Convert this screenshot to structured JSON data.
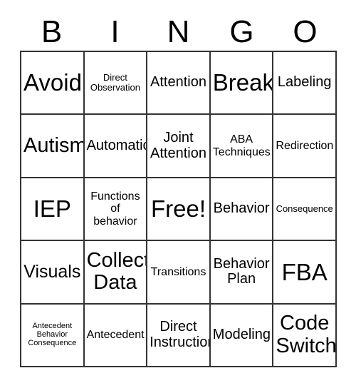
{
  "card": {
    "title_letters": [
      "B",
      "I",
      "N",
      "G",
      "O"
    ],
    "free_space_label": "Free!",
    "border_color": "#333333",
    "background_color": "#ffffff",
    "text_color": "#000000",
    "rows": 5,
    "columns": 5
  },
  "cells": [
    {
      "text": "Avoid",
      "size": "fs-xxl"
    },
    {
      "text": "Direct\nObservation",
      "size": "fs-xs"
    },
    {
      "text": "Attention",
      "size": "fs-md"
    },
    {
      "text": "Break",
      "size": "fs-xxl"
    },
    {
      "text": "Labeling",
      "size": "fs-md"
    },
    {
      "text": "Autism",
      "size": "fs-xl"
    },
    {
      "text": "Automatic",
      "size": "fs-md"
    },
    {
      "text": "Joint\nAttention",
      "size": "fs-md"
    },
    {
      "text": "ABA\nTechniques",
      "size": "fs-sm"
    },
    {
      "text": "Redirection",
      "size": "fs-sm"
    },
    {
      "text": "IEP",
      "size": "fs-xxl"
    },
    {
      "text": "Functions\nof\nbehavior",
      "size": "fs-sm"
    },
    {
      "text": "Free!",
      "size": "fs-xxl"
    },
    {
      "text": "Behavior",
      "size": "fs-md"
    },
    {
      "text": "Consequence",
      "size": "fs-xs"
    },
    {
      "text": "Visuals",
      "size": "fs-lg"
    },
    {
      "text": "Collect\nData",
      "size": "fs-xl"
    },
    {
      "text": "Transitions",
      "size": "fs-sm"
    },
    {
      "text": "Behavior\nPlan",
      "size": "fs-md"
    },
    {
      "text": "FBA",
      "size": "fs-xxl"
    },
    {
      "text": "Antecedent\nBehavior\nConsequence",
      "size": "fs-xxs"
    },
    {
      "text": "Antecedent",
      "size": "fs-sm"
    },
    {
      "text": "Direct\nInstruction",
      "size": "fs-md"
    },
    {
      "text": "Modeling",
      "size": "fs-md"
    },
    {
      "text": "Code\nSwitch",
      "size": "fs-xl"
    }
  ]
}
